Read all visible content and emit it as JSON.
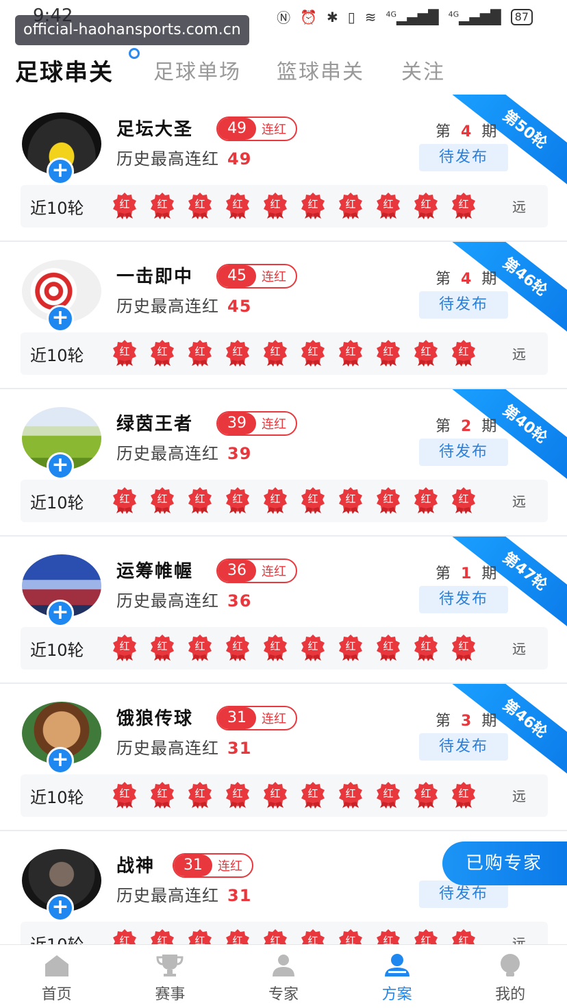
{
  "status_bar": {
    "time": "9:42",
    "network_1": "4G",
    "network_2": "4G",
    "battery": "87"
  },
  "watermark": "official-haohansports.com.cn",
  "tabs": [
    {
      "label": "足球串关",
      "active": true
    },
    {
      "label": "足球单场",
      "active": false
    },
    {
      "label": "篮球串关",
      "active": false
    },
    {
      "label": "关注",
      "active": false
    }
  ],
  "labels": {
    "history_prefix": "历史最高连红",
    "streak_suffix": "连红",
    "recent": "近10轮",
    "far": "远",
    "period_prefix": "第",
    "period_suffix": "期",
    "seal_char": "红"
  },
  "experts": [
    {
      "name": "足坛大圣",
      "streak": "49",
      "history_max": "49",
      "period": "4",
      "status": "待发布",
      "ribbon": "第50轮"
    },
    {
      "name": "一击即中",
      "streak": "45",
      "history_max": "45",
      "period": "4",
      "status": "待发布",
      "ribbon": "第46轮"
    },
    {
      "name": "绿茵王者",
      "streak": "39",
      "history_max": "39",
      "period": "2",
      "status": "待发布",
      "ribbon": "第40轮"
    },
    {
      "name": "运筹帷幄",
      "streak": "36",
      "history_max": "36",
      "period": "1",
      "status": "待发布",
      "ribbon": "第47轮"
    },
    {
      "name": "饿狼传球",
      "streak": "31",
      "history_max": "31",
      "period": "3",
      "status": "待发布",
      "ribbon": "第46轮"
    },
    {
      "name": "战神",
      "streak": "31",
      "history_max": "31",
      "period": "",
      "status": "待发布",
      "ribbon": ""
    }
  ],
  "floating_button": "已购专家",
  "bottom_nav": [
    {
      "label": "首页",
      "icon": "home-icon",
      "active": false
    },
    {
      "label": "赛事",
      "icon": "trophy-icon",
      "active": false
    },
    {
      "label": "专家",
      "icon": "expert-icon",
      "active": false
    },
    {
      "label": "方案",
      "icon": "plan-icon",
      "active": true
    },
    {
      "label": "我的",
      "icon": "profile-icon",
      "active": false
    }
  ],
  "colors": {
    "accent_red": "#e8383d",
    "accent_blue": "#1e88f0"
  }
}
